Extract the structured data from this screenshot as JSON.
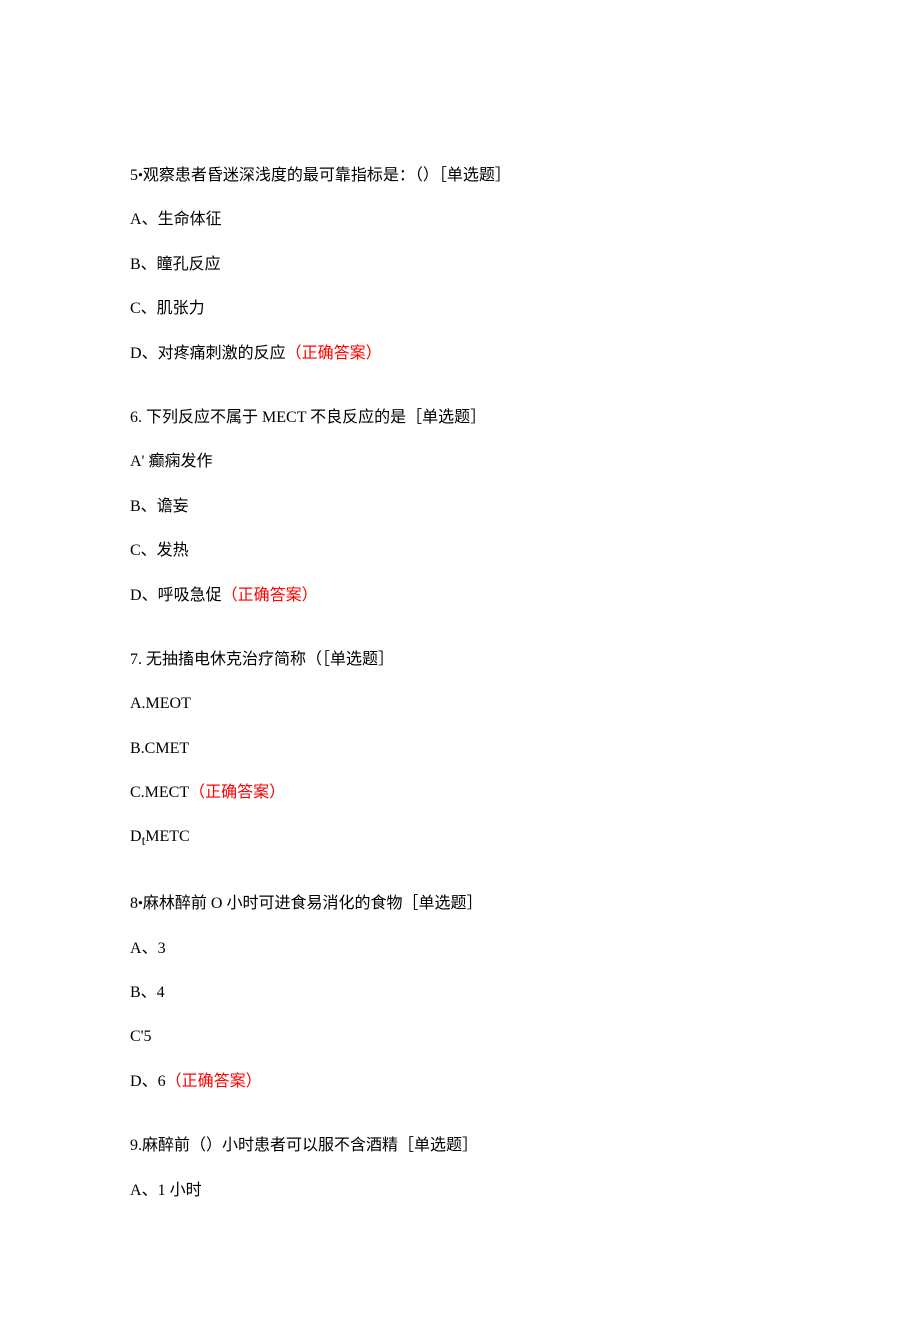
{
  "questions": [
    {
      "stem_prefix": "5",
      "stem_bullet": "•",
      "stem": "观察患者昏迷深浅度的最可靠指标是：（）［单选题］",
      "options": [
        {
          "label": "A、生命体征",
          "correct": ""
        },
        {
          "label": "B、瞳孔反应",
          "correct": ""
        },
        {
          "label": "C、肌张力",
          "correct": ""
        },
        {
          "label": "D、对疼痛刺激的反应",
          "correct": "（正确答案）"
        }
      ]
    },
    {
      "stem_prefix": "6. ",
      "stem_bullet": "",
      "stem_pre": "下列反应不属于 ",
      "stem_latin": "MECT ",
      "stem_post": "不良反应的是［单选题］",
      "options": [
        {
          "label": "A' 癫痫发作",
          "correct": ""
        },
        {
          "label": "B、谵妄",
          "correct": ""
        },
        {
          "label": "C、发热",
          "correct": ""
        },
        {
          "label": "D、呼吸急促",
          "correct": "（正确答案）"
        }
      ]
    },
    {
      "stem_prefix": "7. ",
      "stem_bullet": "",
      "stem": "无抽搐电休克治疗简称（［单选题］",
      "options": [
        {
          "label_latin": "A.MEOT",
          "correct": ""
        },
        {
          "label_latin": "B.CMET",
          "correct": ""
        },
        {
          "label_latin": "C.MECT",
          "correct": "（正确答案）"
        },
        {
          "label_latin_pre": "D",
          "label_sub": "t",
          "label_latin_post": "METC",
          "correct": ""
        }
      ]
    },
    {
      "stem_prefix": "8",
      "stem_bullet": "•",
      "stem": "麻林醉前 O 小时可进食易消化的食物［单选题］",
      "options": [
        {
          "label": "A、3",
          "correct": ""
        },
        {
          "label": "B、4",
          "correct": ""
        },
        {
          "label_latin": "C'5",
          "correct": ""
        },
        {
          "label": "D、6",
          "correct": "（正确答案）"
        }
      ]
    },
    {
      "stem_prefix": "9.",
      "stem_bullet": "",
      "stem": "麻醉前（）小时患者可以服不含酒精［单选题］",
      "options": [
        {
          "label": "A、1 小时",
          "correct": ""
        }
      ]
    }
  ]
}
